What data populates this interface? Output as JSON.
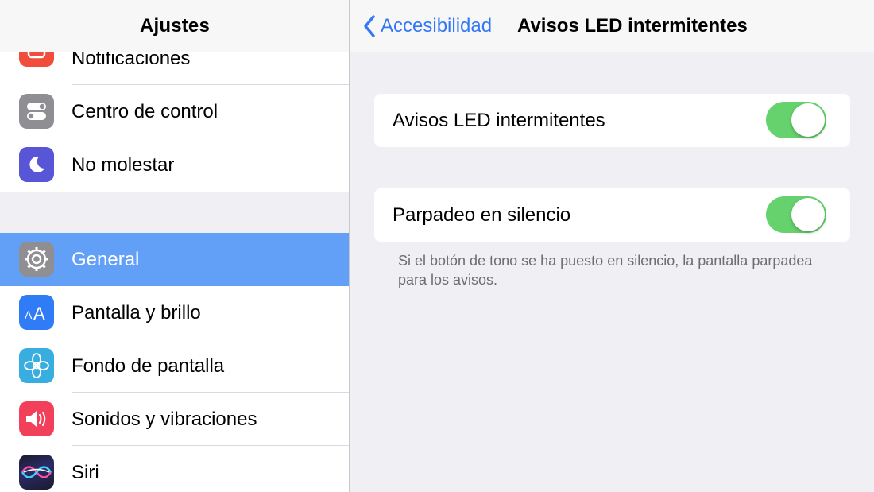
{
  "sidebar": {
    "title": "Ajustes",
    "items": [
      {
        "label": "Notificaciones",
        "icon": "notifications-icon",
        "color": "#f14d3c"
      },
      {
        "label": "Centro de control",
        "icon": "control-center-icon",
        "color": "#8e8e93"
      },
      {
        "label": "No molestar",
        "icon": "moon-icon",
        "color": "#5856d6"
      },
      {
        "label": "General",
        "icon": "gear-icon",
        "color": "#8e8e93",
        "selected": true
      },
      {
        "label": "Pantalla y brillo",
        "icon": "text-size-icon",
        "color": "#2f7cf6"
      },
      {
        "label": "Fondo de pantalla",
        "icon": "flower-icon",
        "color": "#38aee0"
      },
      {
        "label": "Sonidos y vibraciones",
        "icon": "speaker-icon",
        "color": "#f2405a"
      },
      {
        "label": "Siri",
        "icon": "siri-icon",
        "color": "#1a1a2e"
      }
    ]
  },
  "detail": {
    "back_label": "Accesibilidad",
    "title": "Avisos LED intermitentes",
    "settings": [
      {
        "label": "Avisos LED intermitentes",
        "on": true
      },
      {
        "label": "Parpadeo en silencio",
        "on": true
      }
    ],
    "footnote": "Si el botón de tono se ha puesto en silencio, la pantalla parpadea para los avisos."
  },
  "colors": {
    "accent": "#3478f6",
    "selection": "#62a0f7",
    "toggle_on": "#65d26e"
  }
}
